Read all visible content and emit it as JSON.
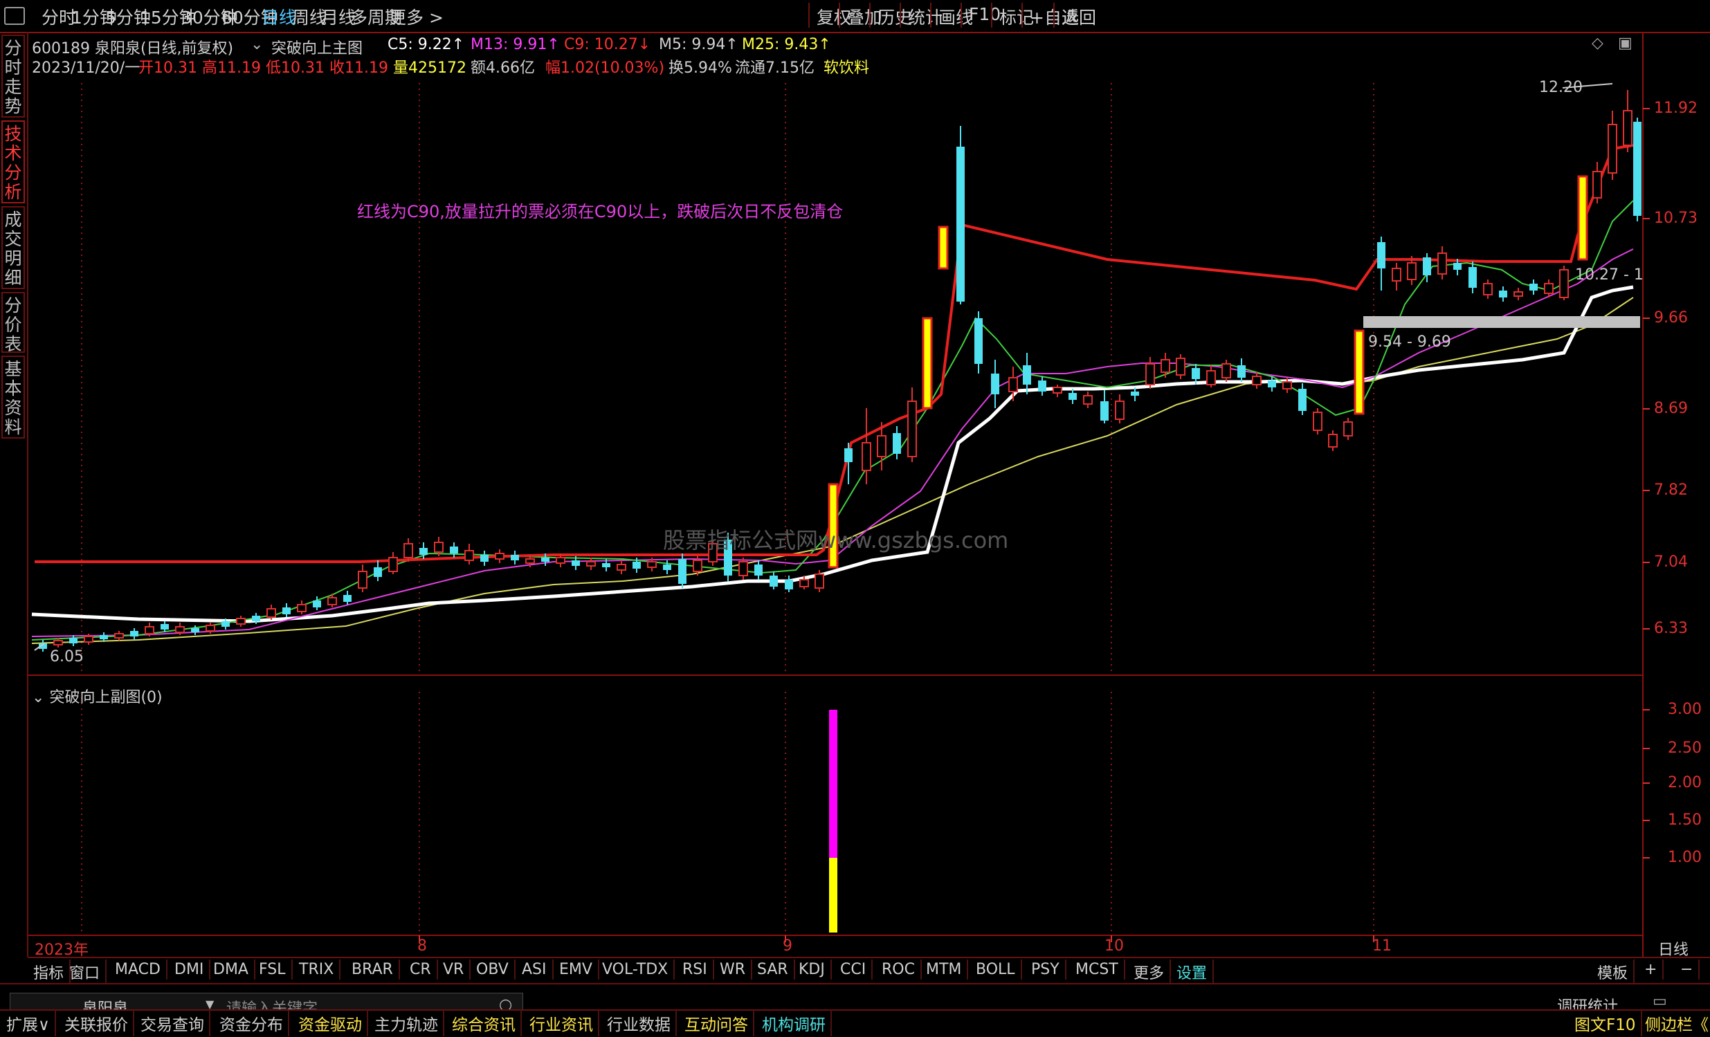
{
  "topbar": {
    "periods": [
      "分时",
      "1分钟",
      "5分钟",
      "15分钟",
      "30分钟",
      "60分钟",
      "日线",
      "周线",
      "月线",
      "多周期",
      "更多 >"
    ],
    "active_period": "日线",
    "right_buttons": [
      "复权",
      "叠加",
      "历史",
      "统计",
      "画线",
      "F10",
      "标记",
      "+自选",
      "返回"
    ]
  },
  "sidebar": {
    "tabs": [
      "分时走势",
      "技术分析",
      "成交明细",
      "分价表",
      "基本资料"
    ],
    "active": "技术分析"
  },
  "header": {
    "stock": "600189 泉阳泉(日线,前复权)",
    "indicator": "突破向上主图",
    "c5": "C5: 9.22↑",
    "m13": "M13: 9.91↑",
    "c9": "C9: 10.27↓",
    "m5": "M5: 9.94↑",
    "m25": "M25: 9.43↑",
    "date": "2023/11/20/一",
    "open": "开10.31",
    "high": "高11.19",
    "low": "低10.31",
    "close": "收11.19",
    "volume": "量425172",
    "amount": "额4.66亿",
    "change": "幅1.02(10.03%)",
    "turnover": "换5.94%",
    "float": "流通7.15亿",
    "sector": "软饮料"
  },
  "annotation": "红线为C90,放量拉升的票必须在C90以上，跌破后次日不反包清仓",
  "watermark": "股票指标公式网www.gszbgs.com",
  "price_axis": [
    "11.92",
    "10.73",
    "9.66",
    "8.69",
    "7.82",
    "7.04",
    "6.33"
  ],
  "markers": {
    "high": "12.20",
    "low": "6.05",
    "range1": "9.54 - 9.69",
    "range2": "10.27 - 1"
  },
  "sub_chart": {
    "title": "突破向上副图(0)",
    "axis": [
      "3.00",
      "2.50",
      "2.00",
      "1.50",
      "1.00"
    ]
  },
  "date_axis": {
    "labels": [
      "2023年",
      "8",
      "9",
      "10",
      "11"
    ],
    "period": "日线"
  },
  "indicator_bar": {
    "items": [
      "指标",
      "窗口",
      "MACD",
      "DMI",
      "DMA",
      "FSL",
      "TRIX",
      "BRAR",
      "CR",
      "VR",
      "OBV",
      "ASI",
      "EMV",
      "VOL-TDX",
      "RSI",
      "WR",
      "SAR",
      "KDJ",
      "CCI",
      "ROC",
      "MTM",
      "BOLL",
      "PSY",
      "MCST",
      "更多",
      "设置"
    ],
    "template": "模板",
    "plus": "+",
    "minus": "−"
  },
  "search": {
    "stock": "泉阳泉",
    "placeholder": "请输入关键字",
    "stat": "调研统计"
  },
  "bottom_bar": {
    "items": [
      "扩展∨",
      "关联报价",
      "交易查询",
      "资金分布",
      "资金驱动",
      "主力轨迹",
      "综合资讯",
      "行业资讯",
      "行业数据",
      "互动问答",
      "机构调研"
    ],
    "right": [
      "图文F10",
      "侧边栏《"
    ]
  },
  "colors": {
    "up": "#e03030",
    "down": "#50e0f0",
    "c90": "#e82020",
    "white_line": "#ffffff",
    "signal_yellow": "#ffff00",
    "signal_magenta": "#ff00ff"
  }
}
